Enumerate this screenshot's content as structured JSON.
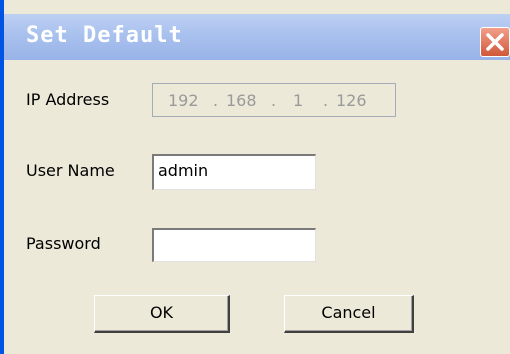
{
  "dialog": {
    "title": "Set Default",
    "close_icon": "close-icon",
    "colors": {
      "titlebar": "#a9c1ee",
      "close_button": "#d0583a",
      "background": "#ece9d8",
      "disabled_text": "#9a9a9a"
    }
  },
  "form": {
    "ip_label": "IP Address",
    "ip_octets": [
      "192",
      "168",
      "1",
      "126"
    ],
    "ip_disabled": true,
    "user_label": "User Name",
    "user_value": "admin",
    "password_label": "Password",
    "password_value": ""
  },
  "buttons": {
    "ok_label": "OK",
    "cancel_label": "Cancel"
  }
}
